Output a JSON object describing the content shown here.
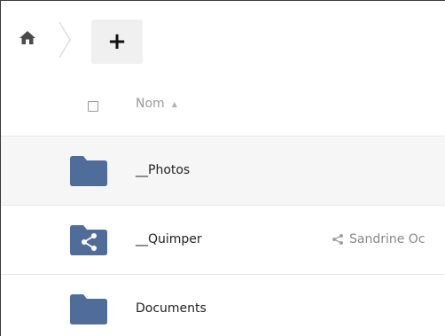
{
  "toolbar": {
    "home_icon": "home-icon",
    "separator_icon": "breadcrumb-separator",
    "add_label": "+"
  },
  "header": {
    "select_all_icon": "checkbox-icon",
    "sort_label": "Nom",
    "sort_arrow": "▲"
  },
  "files": [
    {
      "name": "__Photos",
      "type": "folder",
      "icon": "folder-icon"
    },
    {
      "name": "__Quimper",
      "type": "shared-folder",
      "icon": "shared-folder-icon",
      "shared_with": "Sandrine Oc"
    },
    {
      "name": "Documents",
      "type": "folder",
      "icon": "folder-icon"
    }
  ],
  "colors": {
    "folder": "#4f6d98",
    "hover_row": "#f6f6f6",
    "muted_text": "#9a9a9a"
  }
}
